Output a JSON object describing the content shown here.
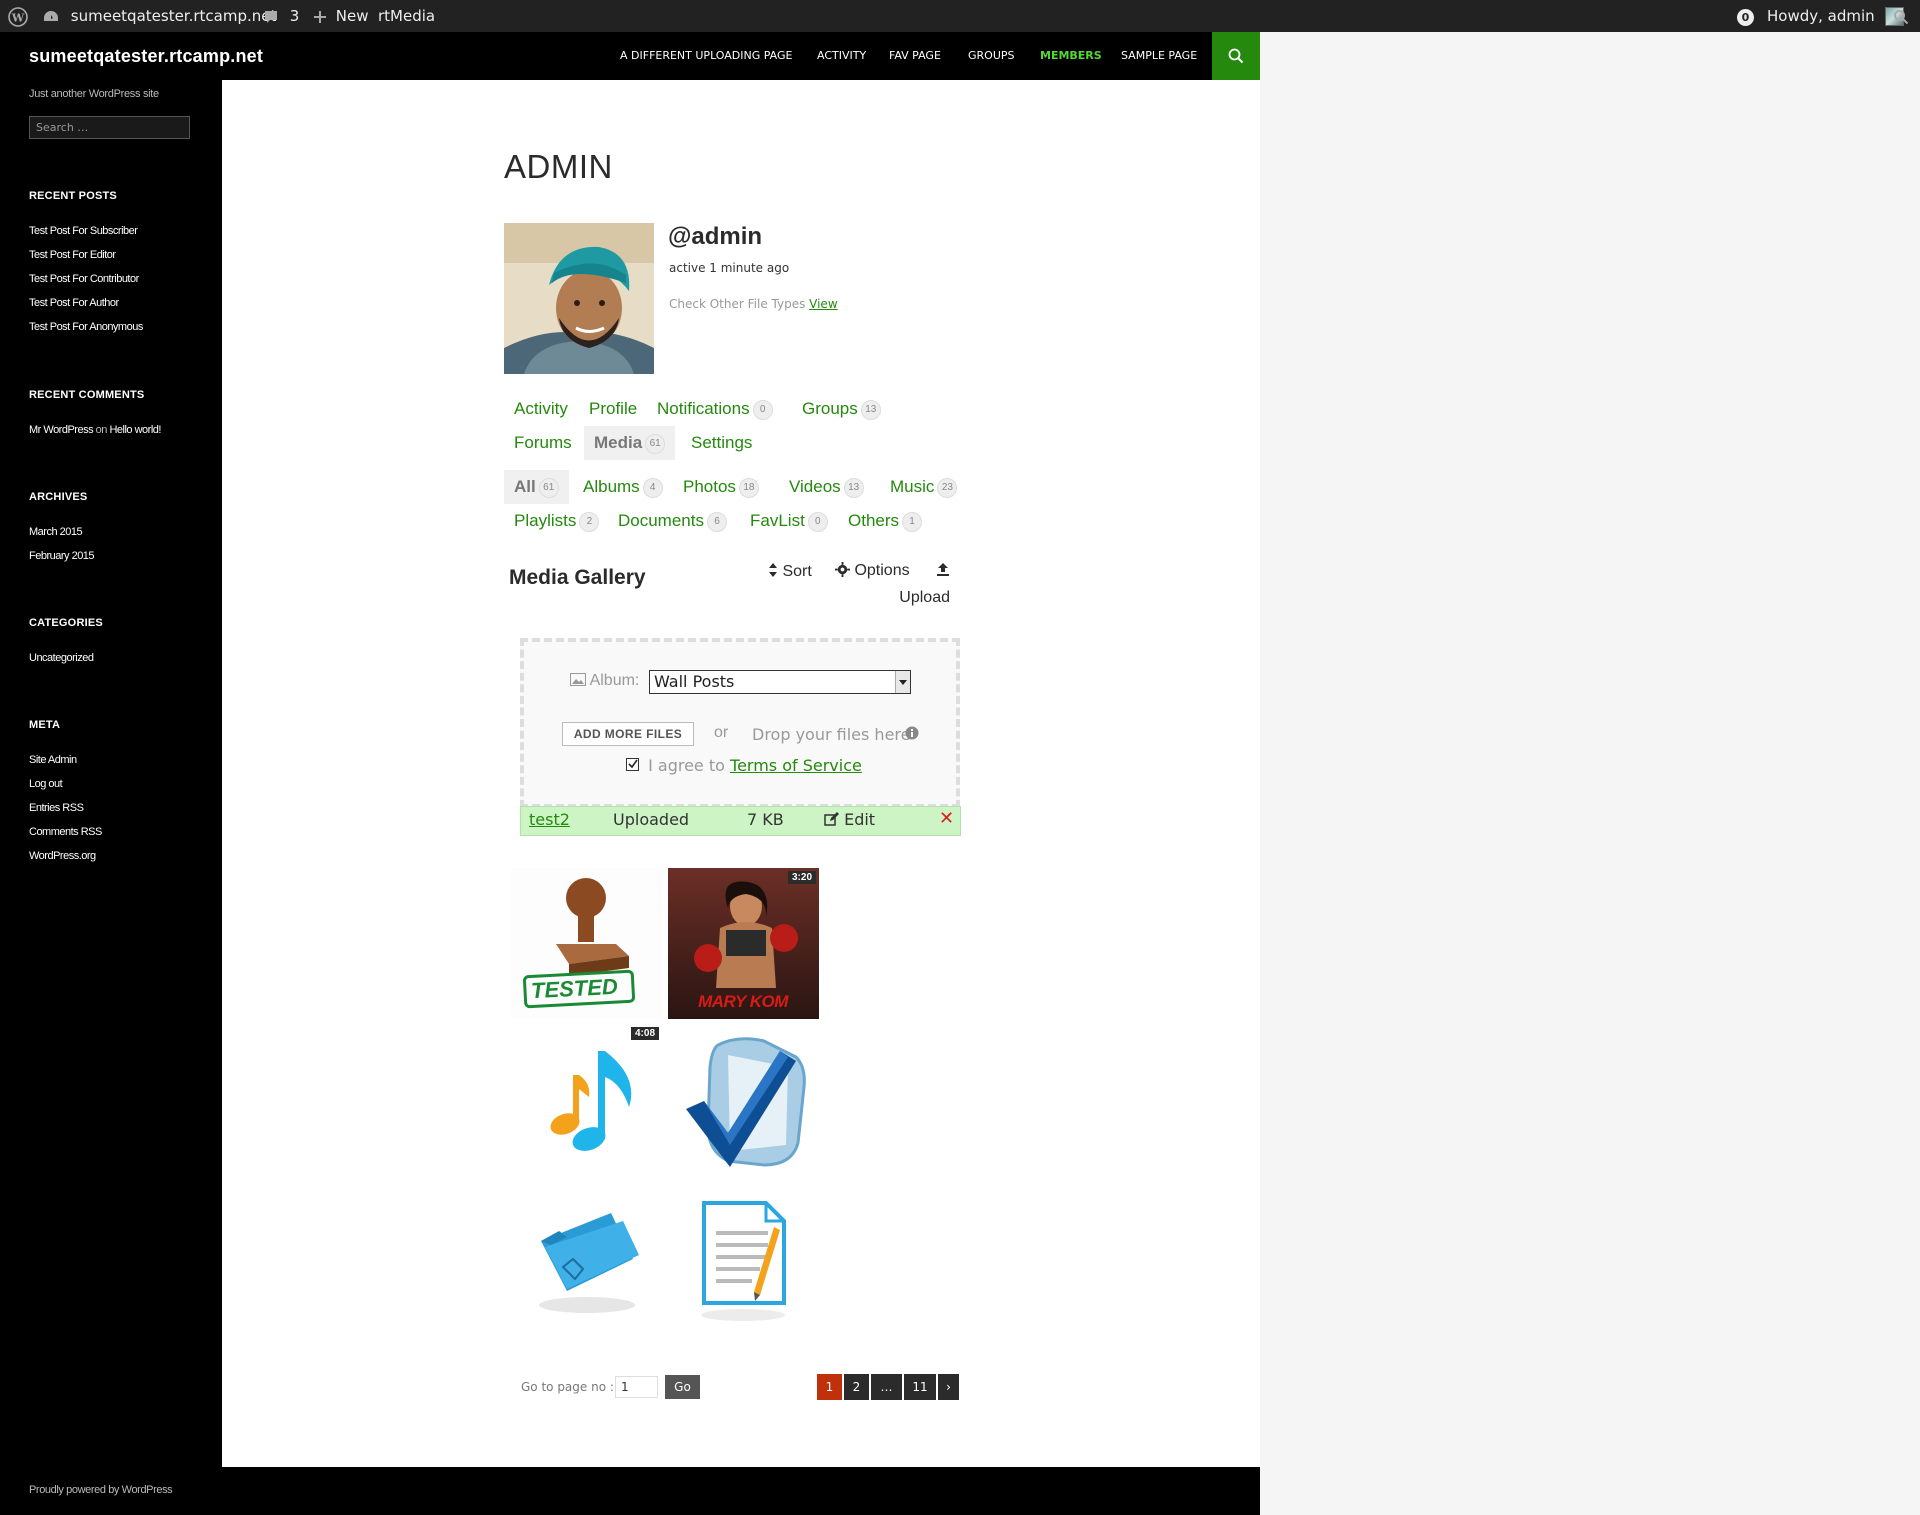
{
  "admin_bar": {
    "site_name": "sumeetqatester.rtcamp.net",
    "comments_count": "3",
    "new_label": "New",
    "rtmedia_label": "rtMedia",
    "notification_count": "0",
    "howdy": "Howdy, admin"
  },
  "site": {
    "title": "sumeetqatester.rtcamp.net",
    "tagline": "Just another WordPress site",
    "search_placeholder": "Search …",
    "powered_by": "Proudly powered by WordPress"
  },
  "nav": [
    {
      "label": "A DIFFERENT UPLOADING PAGE",
      "active": false
    },
    {
      "label": "ACTIVITY",
      "active": false
    },
    {
      "label": "FAV PAGE",
      "active": false
    },
    {
      "label": "GROUPS",
      "active": false
    },
    {
      "label": "MEMBERS",
      "active": true
    },
    {
      "label": "SAMPLE PAGE",
      "active": false
    }
  ],
  "sidebar": {
    "recent_posts_title": "RECENT POSTS",
    "recent_posts": [
      "Test Post For Subscriber",
      "Test Post For Editor",
      "Test Post For Contributor",
      "Test Post For Author",
      "Test Post For Anonymous"
    ],
    "recent_comments_title": "RECENT COMMENTS",
    "recent_comment": {
      "author": "Mr WordPress",
      "on": "on",
      "post": "Hello world!"
    },
    "archives_title": "ARCHIVES",
    "archives": [
      "March 2015",
      "February 2015"
    ],
    "categories_title": "CATEGORIES",
    "categories": [
      "Uncategorized"
    ],
    "meta_title": "META",
    "meta": [
      "Site Admin",
      "Log out",
      "Entries RSS",
      "Comments RSS",
      "WordPress.org"
    ]
  },
  "profile": {
    "page_title": "ADMIN",
    "username": "@admin",
    "activity": "active 1 minute ago",
    "other_types_text": "Check Other File Types",
    "other_types_link": "View"
  },
  "member_tabs": [
    {
      "label": "Activity",
      "count": null
    },
    {
      "label": "Profile",
      "count": null
    },
    {
      "label": "Notifications",
      "count": "0"
    },
    {
      "label": "Groups",
      "count": "13"
    },
    {
      "label": "Forums",
      "count": null
    },
    {
      "label": "Media",
      "count": "61",
      "active": true
    },
    {
      "label": "Settings",
      "count": null
    }
  ],
  "media_tabs": [
    {
      "label": "All",
      "count": "61",
      "active": true
    },
    {
      "label": "Albums",
      "count": "4"
    },
    {
      "label": "Photos",
      "count": "18"
    },
    {
      "label": "Videos",
      "count": "13"
    },
    {
      "label": "Music",
      "count": "23"
    },
    {
      "label": "Playlists",
      "count": "2"
    },
    {
      "label": "Documents",
      "count": "6"
    },
    {
      "label": "FavList",
      "count": "0"
    },
    {
      "label": "Others",
      "count": "1"
    }
  ],
  "gallery": {
    "title": "Media Gallery",
    "sort_label": "Sort",
    "options_label": "Options",
    "upload_label": "Upload"
  },
  "uploader": {
    "album_label": "Album:",
    "album_value": "Wall Posts",
    "add_files_label": "ADD MORE FILES",
    "or_label": "or",
    "drop_label": "Drop your files here",
    "agree_label": "I agree to",
    "terms_label": "Terms of Service",
    "file": {
      "name": "test2",
      "status": "Uploaded",
      "size": "7 KB",
      "edit_label": "Edit"
    }
  },
  "thumbnails": [
    {
      "name": "tested-stamp",
      "duration": null
    },
    {
      "name": "mary-kom-poster",
      "duration": "3:20",
      "poster_text": "MARY KOM"
    },
    {
      "name": "music-note",
      "duration": "4:08"
    },
    {
      "name": "checkmark",
      "duration": null
    },
    {
      "name": "folder",
      "duration": null
    },
    {
      "name": "document",
      "duration": null
    }
  ],
  "tested_text": "TESTED",
  "pagination": {
    "go_to_label": "Go to page no :",
    "page_input": "1",
    "go_label": "Go",
    "pages": [
      "1",
      "2",
      "…",
      "11",
      "›"
    ],
    "current": "1"
  },
  "colors": {
    "accent": "#24890d",
    "active_nav": "#55d737",
    "current_page": "#c0300b"
  }
}
